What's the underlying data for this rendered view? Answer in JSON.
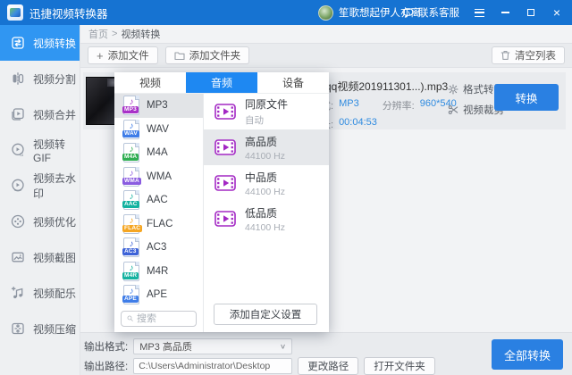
{
  "colors": {
    "titlebar": "#1673d2",
    "sidebar_active": "#3096f2",
    "tab_active": "#1e88f2",
    "button_blue": "#2a80e2",
    "value_text": "#2f8be0",
    "film_icon": "#a328c4"
  },
  "icons": {
    "add": "+",
    "chevron_down": "∨",
    "close": "×",
    "breadcrumb_sep": ">"
  },
  "titlebar": {
    "app_name": "迅捷视频转换器",
    "username": "笙歌想起伊人亦离",
    "support_label": "联系客服"
  },
  "sidebar": {
    "items": [
      {
        "label": "视频转换",
        "active": true
      },
      {
        "label": "视频分割"
      },
      {
        "label": "视频合并"
      },
      {
        "label": "视频转GIF"
      },
      {
        "label": "视频去水印"
      },
      {
        "label": "视频优化"
      },
      {
        "label": "视频截图"
      },
      {
        "label": "视频配乐"
      },
      {
        "label": "视频压缩"
      }
    ]
  },
  "breadcrumb": {
    "home": "首页",
    "current": "视频转换"
  },
  "toolbar": {
    "add_file": "添加文件",
    "add_folder": "添加文件夹",
    "clear_list": "清空列表"
  },
  "file_row": {
    "filename": "qq视频201911301...).mp3",
    "format_label": "格式:",
    "format_value": "MP3",
    "resolution_label": "分辨率:",
    "resolution_value": "960*540",
    "duration_label": "时长:",
    "duration_value": "00:04:53",
    "action_format": "格式转换",
    "action_trim": "视频裁剪",
    "convert_label": "转换"
  },
  "popup": {
    "tabs": [
      {
        "label": "视频"
      },
      {
        "label": "音频",
        "active": true
      },
      {
        "label": "设备"
      }
    ],
    "formats": [
      {
        "name": "MP3",
        "color": "#a832c8",
        "active": true
      },
      {
        "name": "WAV",
        "color": "#3f7de8"
      },
      {
        "name": "M4A",
        "color": "#2fae52"
      },
      {
        "name": "WMA",
        "color": "#8a5ce0"
      },
      {
        "name": "AAC",
        "color": "#14b2a0"
      },
      {
        "name": "FLAC",
        "color": "#f5a623"
      },
      {
        "name": "AC3",
        "color": "#3d63d8"
      },
      {
        "name": "M4R",
        "color": "#14b2a0"
      },
      {
        "name": "APE",
        "color": "#3f7de8"
      }
    ],
    "search_placeholder": "搜索",
    "qualities": [
      {
        "name": "同原文件",
        "sub": "自动"
      },
      {
        "name": "高品质",
        "sub": "44100 Hz",
        "active": true
      },
      {
        "name": "中品质",
        "sub": "44100 Hz"
      },
      {
        "name": "低品质",
        "sub": "44100 Hz"
      }
    ],
    "add_custom_label": "添加自定义设置"
  },
  "footer": {
    "format_label": "输出格式:",
    "format_value": "MP3 高品质",
    "path_label": "输出路径:",
    "path_value": "C:\\Users\\Administrator\\Desktop",
    "change_path": "更改路径",
    "open_folder": "打开文件夹",
    "convert_all": "全部转换"
  }
}
